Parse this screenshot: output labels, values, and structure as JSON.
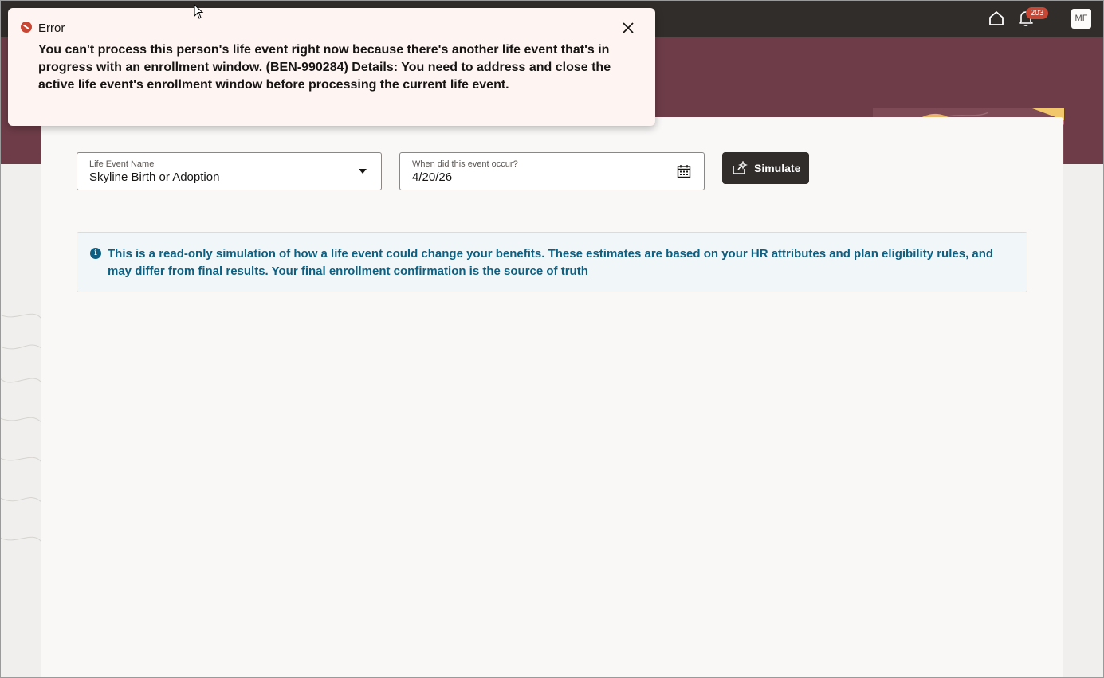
{
  "header": {
    "notification_count": "203",
    "avatar_initials": "MF"
  },
  "form": {
    "life_event": {
      "label": "Life Event Name",
      "value": "Skyline Birth or Adoption"
    },
    "event_date": {
      "label": "When did this event occur?",
      "value": "4/20/26"
    },
    "simulate_label": "Simulate"
  },
  "info": {
    "icon": "i",
    "text": "This is a read-only simulation of how a life event could change your benefits. These estimates are based on your HR attributes and plan eligibility rules, and may differ from final results. Your final enrollment confirmation is the source of truth"
  },
  "error_toast": {
    "title": "Error",
    "message": "You can't process this person's life event right now because there's another life event that's in progress with an enrollment window. (BEN-990284) Details: You need to address and close the active life event's enrollment window before processing the current life event."
  },
  "colors": {
    "header_bg": "#312d2a",
    "banner_bg": "#6d3c48",
    "error_accent": "#c74634",
    "info_text": "#0d6082"
  }
}
